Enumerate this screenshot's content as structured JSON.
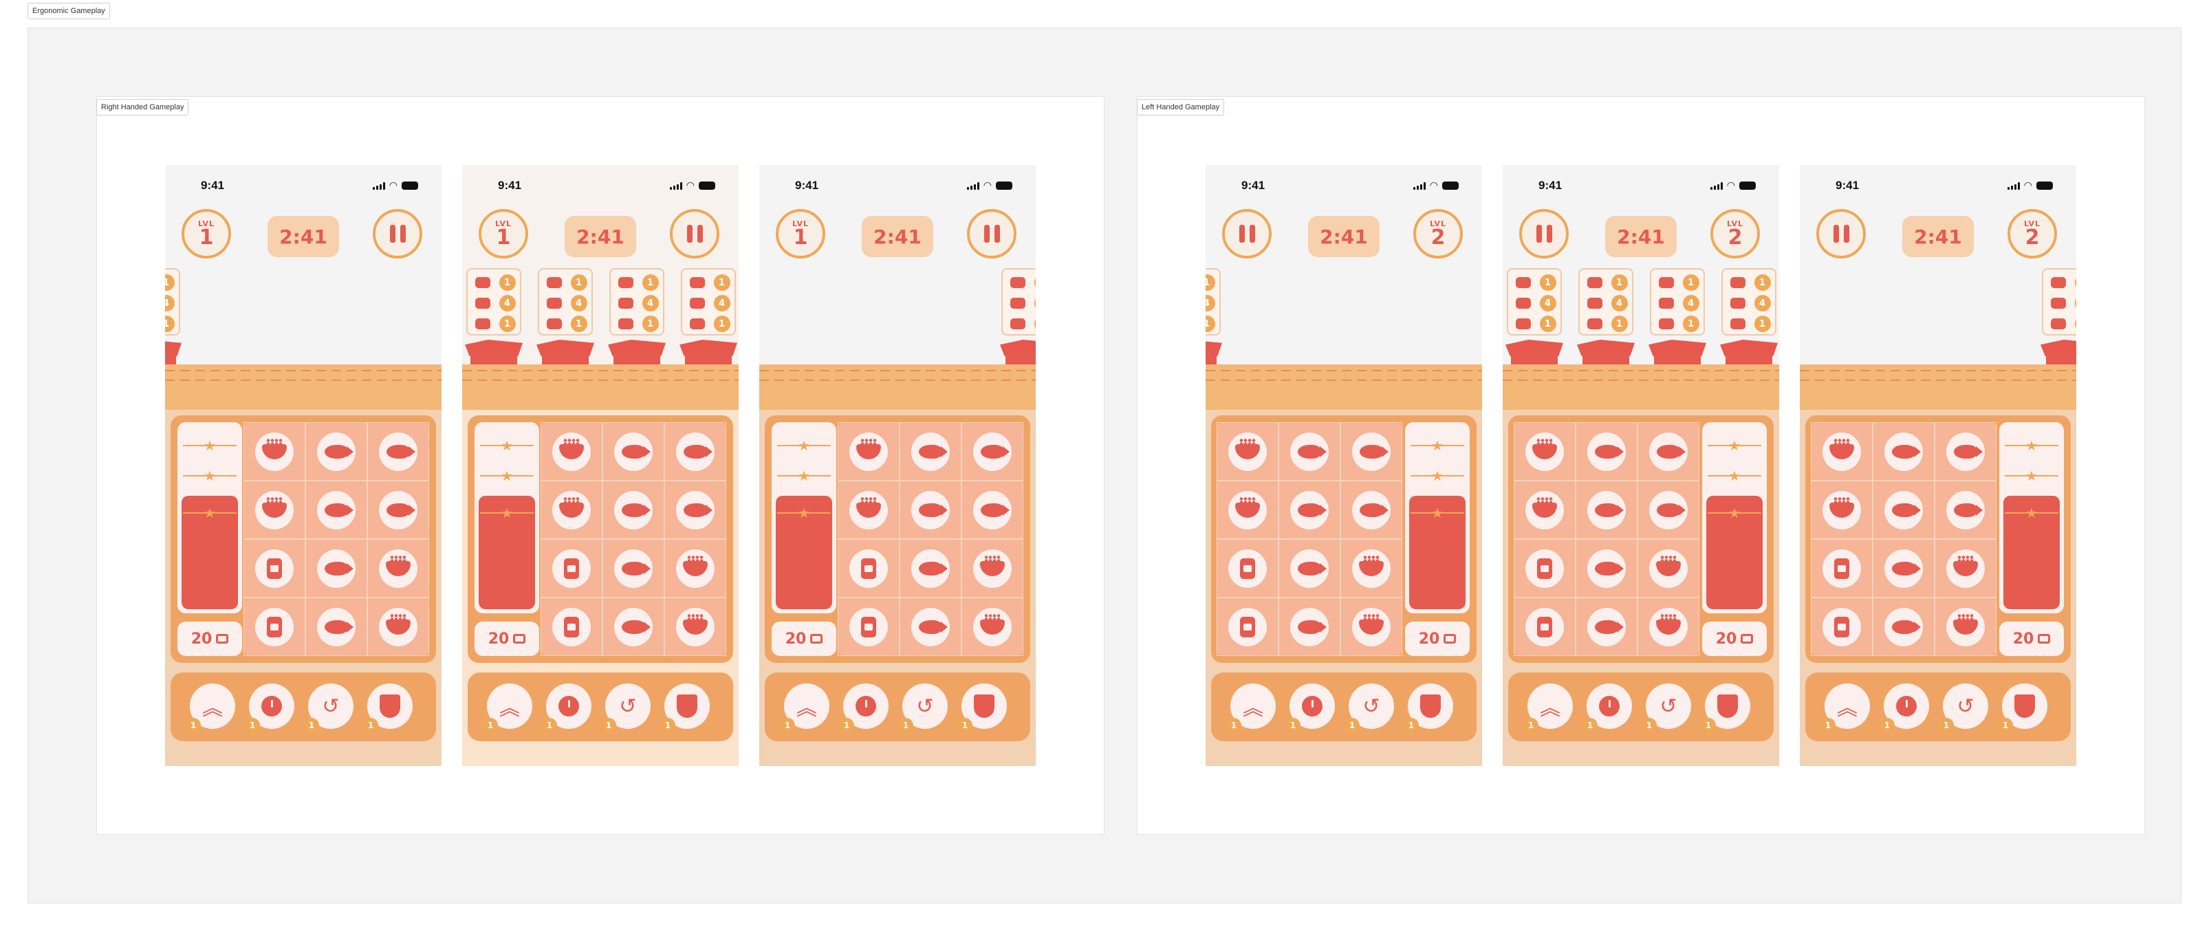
{
  "canvas": {
    "frame_label": "Ergonomic Gameplay"
  },
  "groups": [
    {
      "label": "Right Handed Gameplay",
      "handedness": "right"
    },
    {
      "label": "Left Handed Gameplay",
      "handedness": "left"
    }
  ],
  "status_bar": {
    "time": "9:41"
  },
  "hud": {
    "level_label": "LVL",
    "timer": "2:41"
  },
  "screens": [
    {
      "group": 0,
      "level": "1",
      "order_slots": "partial-left",
      "tint": "normal"
    },
    {
      "group": 0,
      "level": "1",
      "order_slots": "full",
      "tint": "light"
    },
    {
      "group": 0,
      "level": "1",
      "order_slots": "partial-right",
      "tint": "normal"
    },
    {
      "group": 1,
      "level": "2",
      "order_slots": "partial-left",
      "tint": "normal"
    },
    {
      "group": 1,
      "level": "2",
      "order_slots": "full",
      "tint": "normal"
    },
    {
      "group": 1,
      "level": "2",
      "order_slots": "partial-right",
      "tint": "normal"
    }
  ],
  "order_ticket": {
    "items": [
      {
        "icon": "bowl-icon",
        "count": "1"
      },
      {
        "icon": "fish-icon",
        "count": "4"
      },
      {
        "icon": "jar-icon",
        "count": "1"
      }
    ]
  },
  "board": {
    "rows": [
      [
        "bowl-icon",
        "fish-icon",
        "fish-icon"
      ],
      [
        "bowl-icon",
        "fish-icon",
        "fish-icon"
      ],
      [
        "jar-icon",
        "fish-icon",
        "bowl-icon"
      ],
      [
        "jar-icon",
        "fish-icon",
        "bowl-icon"
      ]
    ],
    "progress_fraction": 0.62,
    "coins": "20"
  },
  "powerups": [
    {
      "name": "boost-icon",
      "glyph": "︽",
      "cost": "1"
    },
    {
      "name": "clock-icon",
      "glyph": "",
      "cost": "1"
    },
    {
      "name": "undo-icon",
      "glyph": "↺",
      "cost": "1"
    },
    {
      "name": "shield-icon",
      "glyph": "",
      "cost": "1"
    }
  ],
  "colors": {
    "accent": "#e55b4f",
    "orange": "#f0a856",
    "board": "#f0a463",
    "cream": "#fbf0ee"
  }
}
